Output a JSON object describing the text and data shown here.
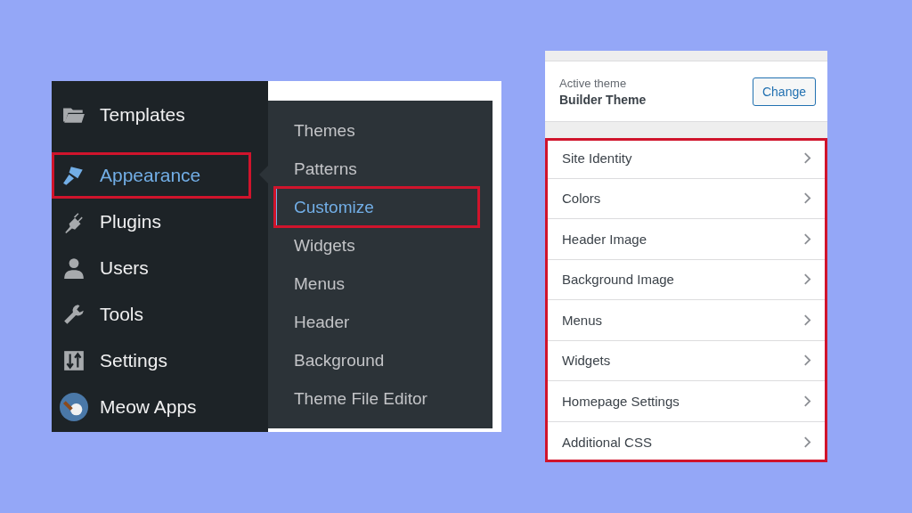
{
  "admin_menu": {
    "items": [
      {
        "label": "Templates",
        "selected": false,
        "highlighted": false
      },
      {
        "label": "Appearance",
        "selected": true,
        "highlighted": true
      },
      {
        "label": "Plugins",
        "selected": false,
        "highlighted": false
      },
      {
        "label": "Users",
        "selected": false,
        "highlighted": false
      },
      {
        "label": "Tools",
        "selected": false,
        "highlighted": false
      },
      {
        "label": "Settings",
        "selected": false,
        "highlighted": false
      },
      {
        "label": "Meow Apps",
        "selected": false,
        "highlighted": false
      }
    ]
  },
  "appearance_submenu": {
    "items": [
      {
        "label": "Themes",
        "selected": false,
        "highlighted": false
      },
      {
        "label": "Patterns",
        "selected": false,
        "highlighted": false
      },
      {
        "label": "Customize",
        "selected": true,
        "highlighted": true
      },
      {
        "label": "Widgets",
        "selected": false,
        "highlighted": false
      },
      {
        "label": "Menus",
        "selected": false,
        "highlighted": false
      },
      {
        "label": "Header",
        "selected": false,
        "highlighted": false
      },
      {
        "label": "Background",
        "selected": false,
        "highlighted": false
      },
      {
        "label": "Theme File Editor",
        "selected": false,
        "highlighted": false
      }
    ]
  },
  "customizer": {
    "active_theme_label": "Active theme",
    "theme_name": "Builder Theme",
    "change_button": "Change",
    "sections_highlighted": true,
    "sections": [
      "Site Identity",
      "Colors",
      "Header Image",
      "Background Image",
      "Menus",
      "Widgets",
      "Homepage Settings",
      "Additional CSS"
    ]
  }
}
